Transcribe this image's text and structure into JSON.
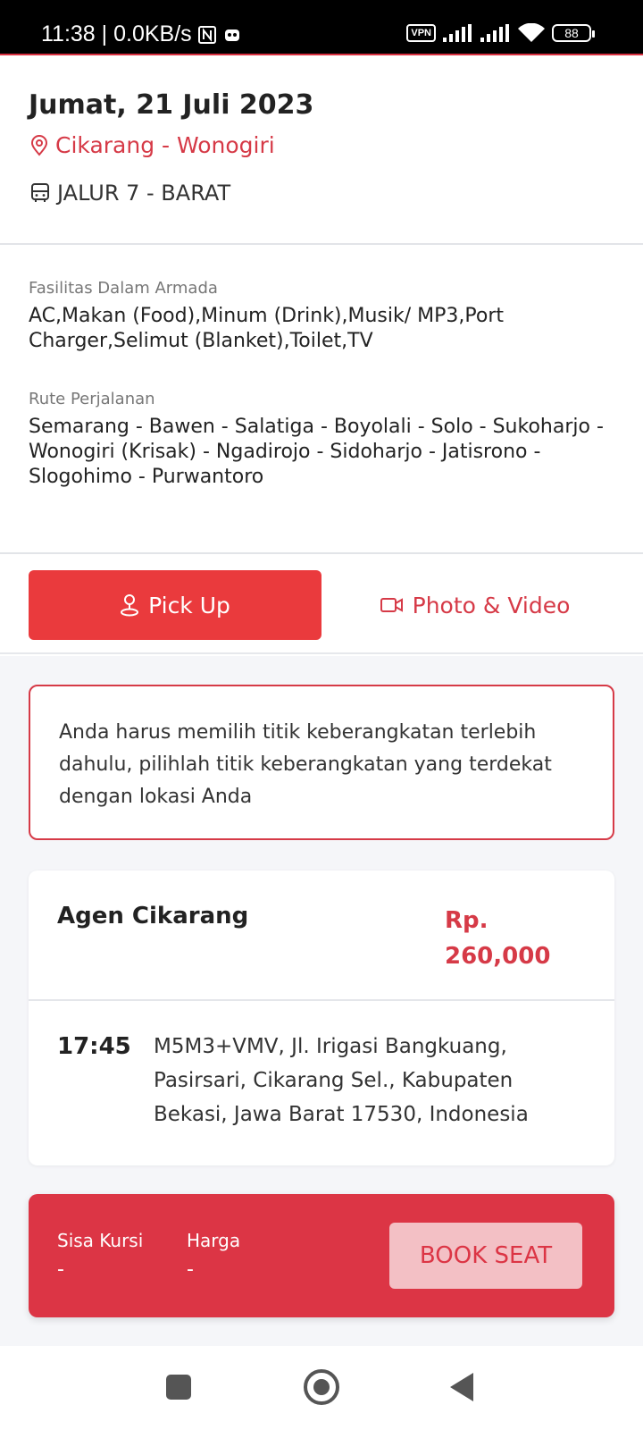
{
  "status_bar": {
    "time_speed": "11:38 | 0.0KB/s",
    "vpn": "VPN",
    "battery": "88"
  },
  "header": {
    "date": "Jumat, 21 Juli 2023",
    "route": "Cikarang - Wonogiri",
    "jalur": "JALUR 7 - BARAT"
  },
  "facilities": {
    "label": "Fasilitas Dalam Armada",
    "value": "AC,Makan (Food),Minum (Drink),Musik/ MP3,Port Charger,Selimut (Blanket),Toilet,TV"
  },
  "rute": {
    "label": "Rute Perjalanan",
    "value": "Semarang - Bawen - Salatiga - Boyolali - Solo - Sukoharjo - Wonogiri (Krisak) - Ngadirojo - Sidoharjo - Jatisrono - Slogohimo - Purwantoro"
  },
  "tabs": {
    "pickup": "Pick Up",
    "media": "Photo & Video",
    "active": "pickup"
  },
  "notice": "Anda harus memilih titik keberangkatan terlebih dahulu, pilihlah titik keberangkatan yang terdekat dengan lokasi Anda",
  "agent": {
    "name": "Agen Cikarang",
    "price": "Rp. 260,000",
    "time": "17:45",
    "address": "M5M3+VMV, Jl. Irigasi Bangkuang, Pasirsari, Cikarang Sel., Kabupaten Bekasi, Jawa Barat 17530, Indonesia"
  },
  "booking": {
    "seats_label": "Sisa Kursi",
    "seats_value": "-",
    "price_label": "Harga",
    "price_value": "-",
    "button": "BOOK SEAT"
  },
  "colors": {
    "accent": "#dc3545",
    "tab_active": "#ea3a3d",
    "button_disabled": "#f3c0c5"
  },
  "icons": [
    "location-pin-icon",
    "bus-icon",
    "pickup-person-icon",
    "video-camera-icon",
    "nfc-icon",
    "notification-icon",
    "signal-icon",
    "wifi-icon",
    "battery-icon"
  ]
}
